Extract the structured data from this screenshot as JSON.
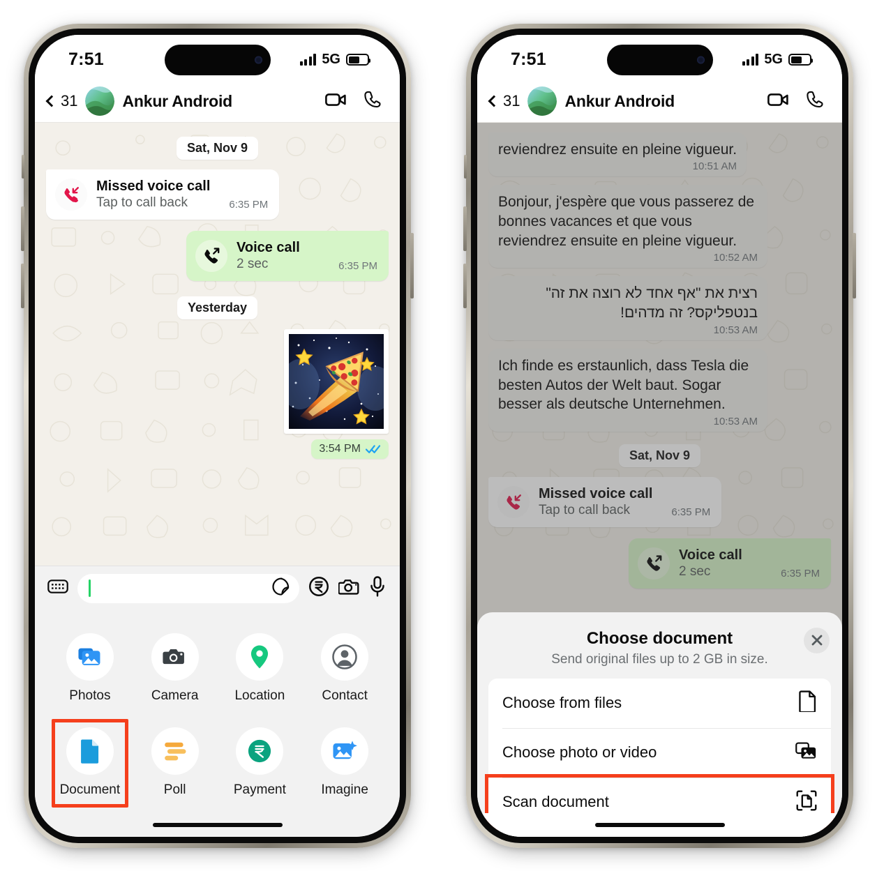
{
  "left_phone": {
    "status_bar": {
      "time": "7:51",
      "network": "5G",
      "signal_icon": "signal-bars-icon",
      "battery_icon": "battery-icon"
    },
    "chat_header": {
      "back_icon": "chevron-left-icon",
      "unread_count": "31",
      "avatar_icon": "contact-avatar",
      "contact_name": "Ankur Android",
      "video_call_icon": "video-camera-icon",
      "voice_call_icon": "phone-handset-icon"
    },
    "messages": [
      {
        "type": "day_separator",
        "label": "Sat, Nov 9"
      },
      {
        "type": "call",
        "direction": "in",
        "icon": "missed-call-icon",
        "title": "Missed voice call",
        "subtitle": "Tap to call back",
        "time": "6:35 PM"
      },
      {
        "type": "call",
        "direction": "out",
        "icon": "outgoing-call-icon",
        "title": "Voice call",
        "subtitle": "2 sec",
        "time": "6:35 PM"
      },
      {
        "type": "day_separator",
        "label": "Yesterday"
      },
      {
        "type": "sticker",
        "description": "pizza comet sticker",
        "time": "3:54 PM",
        "status_icon": "double-check-blue"
      }
    ],
    "input_bar": {
      "keyboard_icon": "keyboard-icon",
      "placeholder": "",
      "value": "",
      "sticker_icon": "sticker-icon",
      "payment_icon": "rupee-icon",
      "camera_icon": "camera-icon",
      "mic_icon": "microphone-icon"
    },
    "attachment_grid": [
      {
        "label": "Photos",
        "icon": "photos-icon",
        "highlighted": false
      },
      {
        "label": "Camera",
        "icon": "camera-icon",
        "highlighted": false
      },
      {
        "label": "Location",
        "icon": "location-pin-icon",
        "highlighted": false
      },
      {
        "label": "Contact",
        "icon": "contact-icon",
        "highlighted": false
      },
      {
        "label": "Document",
        "icon": "document-icon",
        "highlighted": true
      },
      {
        "label": "Poll",
        "icon": "poll-icon",
        "highlighted": false
      },
      {
        "label": "Payment",
        "icon": "payment-rupee-icon",
        "highlighted": false
      },
      {
        "label": "Imagine",
        "icon": "imagine-ai-icon",
        "highlighted": false
      }
    ],
    "highlight_color": "#F53F1C"
  },
  "right_phone": {
    "status_bar": {
      "time": "7:51",
      "network": "5G",
      "signal_icon": "signal-bars-icon",
      "battery_icon": "battery-icon"
    },
    "chat_header": {
      "back_icon": "chevron-left-icon",
      "unread_count": "31",
      "avatar_icon": "contact-avatar",
      "contact_name": "Ankur Android",
      "video_call_icon": "video-camera-icon",
      "voice_call_icon": "phone-handset-icon"
    },
    "messages": [
      {
        "type": "text",
        "text": "reviendrez ensuite en pleine vigueur.",
        "time": "10:51 AM",
        "rtl": false
      },
      {
        "type": "text",
        "text": "Bonjour, j'espère que vous passerez de bonnes vacances et que vous reviendrez ensuite en pleine vigueur.",
        "time": "10:52 AM",
        "rtl": false
      },
      {
        "type": "text",
        "text": "רצית את \"אף אחד לא רוצה את זה\" בנטפליקס? זה מדהים!",
        "time": "10:53 AM",
        "rtl": true
      },
      {
        "type": "text",
        "text": "Ich finde es erstaunlich, dass Tesla die besten Autos der Welt baut. Sogar besser als deutsche Unternehmen.",
        "time": "10:53 AM",
        "rtl": false
      },
      {
        "type": "day_separator",
        "label": "Sat, Nov 9"
      },
      {
        "type": "call",
        "direction": "in",
        "icon": "missed-call-icon",
        "title": "Missed voice call",
        "subtitle": "Tap to call back",
        "time": "6:35 PM"
      },
      {
        "type": "call",
        "direction": "out",
        "icon": "outgoing-call-icon",
        "title": "Voice call",
        "subtitle": "2 sec",
        "time": "6:35 PM"
      }
    ],
    "sheet": {
      "title": "Choose document",
      "subtitle": "Send original files up to 2 GB in size.",
      "close_icon": "close-x-icon",
      "rows": [
        {
          "label": "Choose from files",
          "icon": "file-icon",
          "highlighted": false
        },
        {
          "label": "Choose photo or video",
          "icon": "photo-video-icon",
          "highlighted": false
        },
        {
          "label": "Scan document",
          "icon": "scan-document-icon",
          "highlighted": true
        }
      ]
    },
    "highlight_color": "#F53F1C"
  }
}
